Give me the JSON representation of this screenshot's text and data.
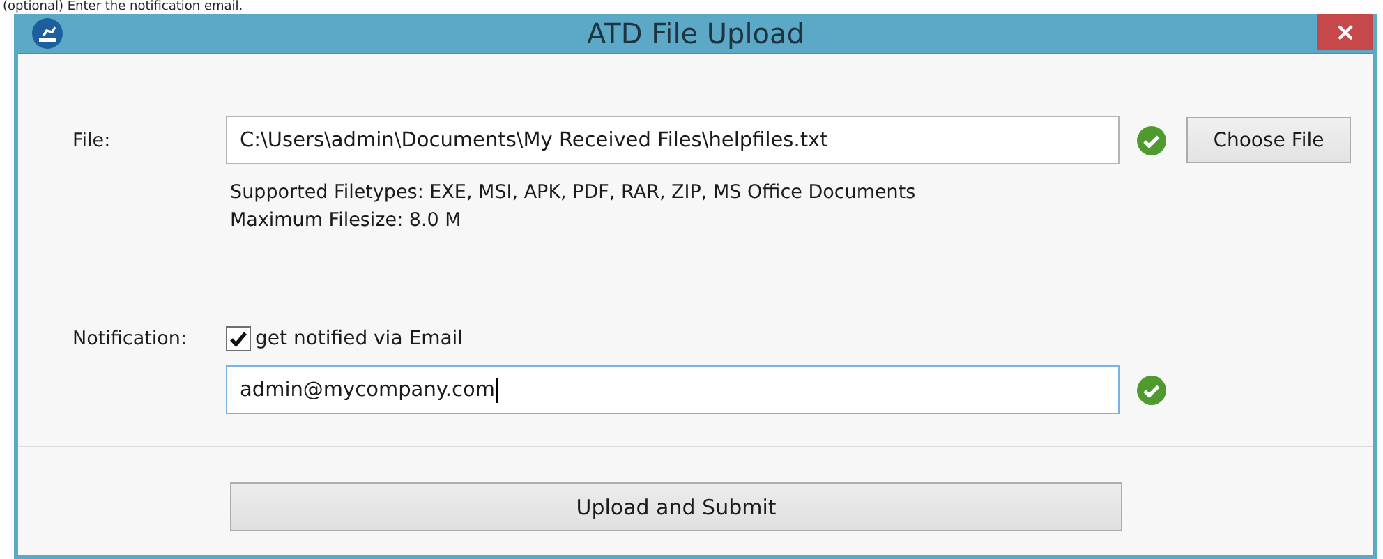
{
  "page_heading": "(optional) Enter the notification email.",
  "window": {
    "title": "ATD File Upload",
    "close": "×"
  },
  "file": {
    "label": "File:",
    "value": "C:\\Users\\admin\\Documents\\My Received Files\\helpfiles.txt",
    "valid": true,
    "button": "Choose File",
    "hints": [
      "Supported Filetypes: EXE, MSI, APK, PDF, RAR, ZIP, MS Office Documents",
      "Maximum Filesize: 8.0 M"
    ]
  },
  "notification": {
    "label": "Notification:",
    "checkbox": {
      "label": "get notified via Email",
      "checked": true
    },
    "email": {
      "value": "admin@mycompany.com",
      "valid": true,
      "focused": true
    }
  },
  "submit": "Upload and Submit"
}
